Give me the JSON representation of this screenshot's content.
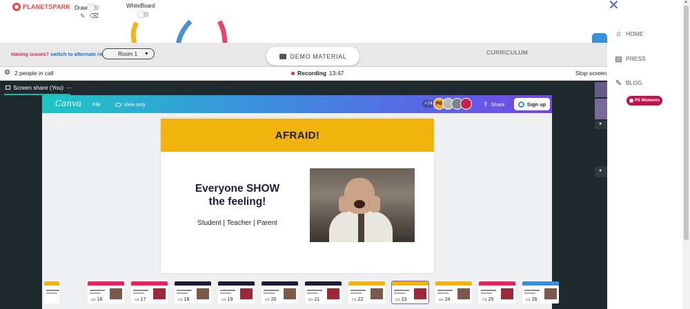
{
  "brand": {
    "name": "PLANETSPARK"
  },
  "toolbar": {
    "draw_label": "Draw",
    "whiteboard_label": "WhiteBoard",
    "pencil_icon": "pencil-icon",
    "eraser_icon": "eraser-icon"
  },
  "header": {
    "issues_text": "Having issues?",
    "issues_link": "switch to alternate room",
    "room_label": "Room 1",
    "room_caret": "▼",
    "demo_material": "DEMO MATERIAL",
    "curriculum": "CURRICULUM"
  },
  "call": {
    "people": "2 people in call",
    "recording_label": "Recording",
    "recording_time": "13:47",
    "stop_label": "Stop screen"
  },
  "screen_share": {
    "tab_label": "Screen share (You)",
    "menu": "···"
  },
  "canva": {
    "logo": "Canva",
    "file": "File",
    "view_only": "View only",
    "avatar_count": "+74",
    "avatar_initials": "PB",
    "share": "Share",
    "signup": "Sign up"
  },
  "slide": {
    "title": "AFRAID!",
    "heading_line1": "Everyone SHOW",
    "heading_line2": "the feeling!",
    "subtitle": "Student | Teacher | Parent"
  },
  "filmstrip": {
    "items": [
      {
        "num": "",
        "color": "#f1b40f"
      },
      {
        "num": "16",
        "color": "#e0245e"
      },
      {
        "num": "17",
        "color": "#e0245e"
      },
      {
        "num": "18",
        "color": "#1d1d3a"
      },
      {
        "num": "19",
        "color": "#1d1d3a"
      },
      {
        "num": "20",
        "color": "#1d1d3a"
      },
      {
        "num": "21",
        "color": "#1d1d3a"
      },
      {
        "num": "22",
        "color": "#f1b40f"
      },
      {
        "num": "23",
        "color": "#f1b40f"
      },
      {
        "num": "24",
        "color": "#f1b40f"
      },
      {
        "num": "25",
        "color": "#e0245e"
      },
      {
        "num": "26",
        "color": "#3c8de0"
      }
    ],
    "selected_num": "23"
  },
  "rightnav": {
    "home": "HOME",
    "press": "PRESS",
    "blog": "BLOG",
    "ps_moments": "PS Moments"
  },
  "colors": {
    "accent_red": "#e0245e",
    "link_blue": "#1a6fd1",
    "slide_yellow": "#f1b40f",
    "stage_dark": "#1f2a2e",
    "badge": "#c1134a"
  }
}
